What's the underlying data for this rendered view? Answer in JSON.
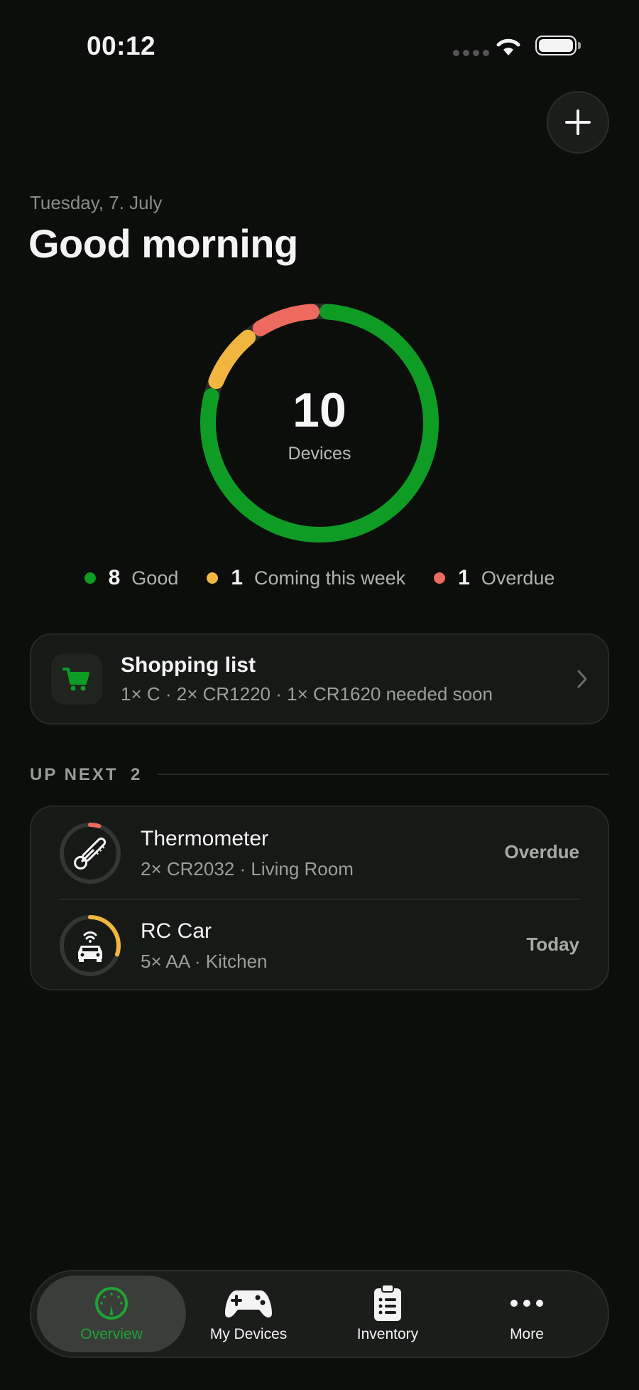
{
  "status_bar": {
    "time": "00:12"
  },
  "header": {
    "date": "Tuesday, 7. July",
    "greeting": "Good morning"
  },
  "summary": {
    "device_count": "10",
    "device_label": "Devices",
    "segments": [
      {
        "name": "Good",
        "count": "8",
        "label": "Good",
        "color": "#0e9c25"
      },
      {
        "name": "Coming this week",
        "count": "1",
        "label": "Coming this week",
        "color": "#f0b640"
      },
      {
        "name": "Overdue",
        "count": "1",
        "label": "Overdue",
        "color": "#ee6a5e"
      }
    ]
  },
  "shopping": {
    "title": "Shopping list",
    "subtitle": "1× C · 2× CR1220 · 1× CR1620 needed soon",
    "icon": "cart-icon",
    "accent": "#0e9c25"
  },
  "up_next": {
    "label": "UP NEXT",
    "count": "2",
    "items": [
      {
        "title": "Thermometer",
        "subtitle": "2× CR2032 · Living Room",
        "status": "Overdue",
        "icon": "thermometer-icon",
        "progress": 0.05,
        "color": "#ee6a5e"
      },
      {
        "title": "RC Car",
        "subtitle": "5× AA · Kitchen",
        "status": "Today",
        "icon": "rc-car-icon",
        "progress": 0.3,
        "color": "#f0b640"
      }
    ]
  },
  "tabbar": {
    "tabs": [
      {
        "label": "Overview",
        "icon": "gauge-icon",
        "active": true
      },
      {
        "label": "My Devices",
        "icon": "gamepad-icon",
        "active": false
      },
      {
        "label": "Inventory",
        "icon": "clipboard-icon",
        "active": false
      },
      {
        "label": "More",
        "icon": "ellipsis-icon",
        "active": false
      }
    ],
    "active_color": "#1fa233"
  }
}
